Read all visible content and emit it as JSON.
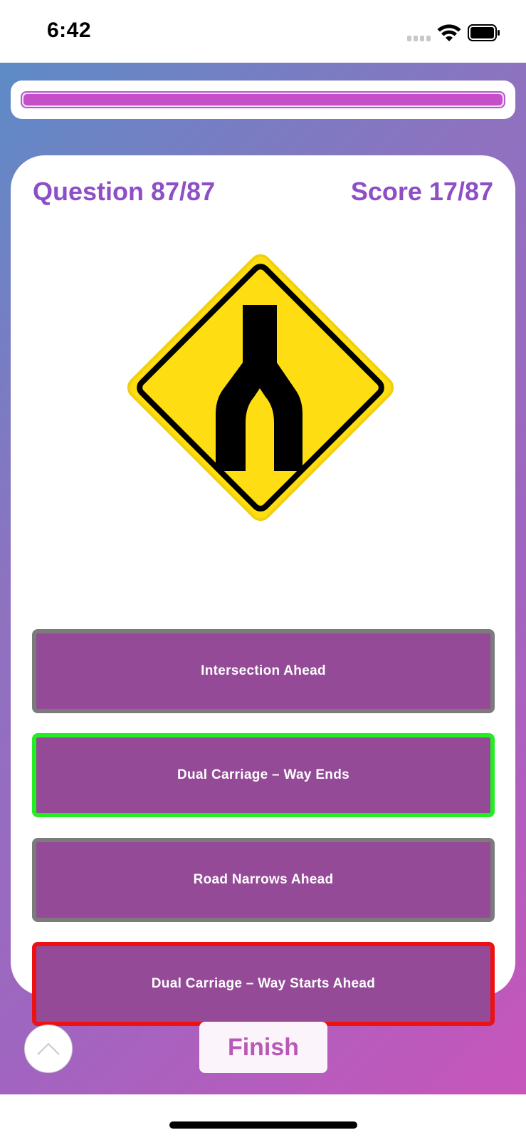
{
  "status_bar": {
    "time": "6:42"
  },
  "progress": {
    "current": 87,
    "total": 87,
    "fraction": 1.0,
    "fill_color": "#c54fc8"
  },
  "quiz": {
    "question_label": "Question 87/87",
    "score_label": "Score 17/87",
    "sign_icon": "dual-carriageway-starts-sign-icon",
    "answers": [
      {
        "label": "Intersection Ahead",
        "state": "neutral"
      },
      {
        "label": "Dual Carriage – Way Ends",
        "state": "correct"
      },
      {
        "label": "Road Narrows Ahead",
        "state": "neutral"
      },
      {
        "label": "Dual Carriage – Way Starts Ahead",
        "state": "wrong"
      }
    ]
  },
  "controls": {
    "scroll_up_icon": "chevron-up-icon",
    "finish_label": "Finish"
  },
  "colors": {
    "accent": "#8d4ec6",
    "answer_bg": "#944a97",
    "correct_border": "#22ee22",
    "wrong_border": "#ee1111",
    "neutral_border": "#7b7b7b",
    "sign_yellow": "#fede12"
  }
}
